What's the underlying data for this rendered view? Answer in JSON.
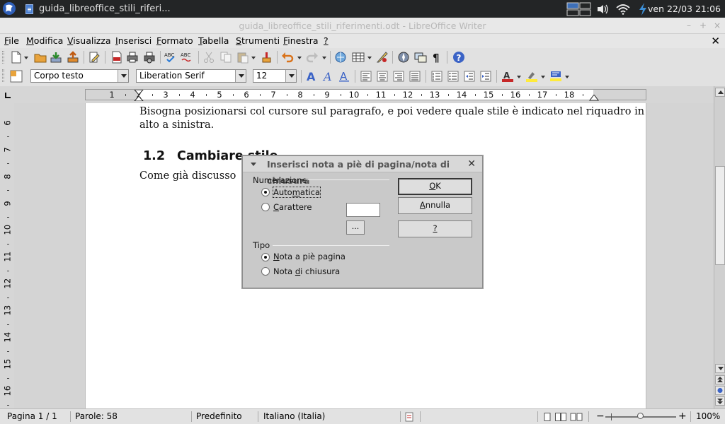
{
  "panel": {
    "task_title": "guida_libreoffice_stili_riferi...",
    "clock": "ven 22/03 21:06"
  },
  "window": {
    "title": "guida_libreoffice_stili_riferimenti.odt - LibreOffice Writer",
    "min": "–",
    "max": "+",
    "close": "×"
  },
  "menubar": {
    "items": [
      {
        "label": "File",
        "u": "F",
        "rest": "ile"
      },
      {
        "label": "Modifica",
        "u": "M",
        "rest": "odifica"
      },
      {
        "label": "Visualizza",
        "u": "V",
        "rest": "isualizza"
      },
      {
        "label": "Inserisci",
        "u": "I",
        "rest": "nserisci"
      },
      {
        "label": "Formato",
        "u": "F",
        "rest": "ormato"
      },
      {
        "label": "Tabella",
        "u": "T",
        "rest": "abella"
      },
      {
        "label": "Strumenti",
        "u": "S",
        "rest": "trumenti"
      },
      {
        "label": "Finestra",
        "u": "F",
        "rest": "inestra"
      },
      {
        "label": "?",
        "u": "?",
        "rest": ""
      }
    ],
    "close_doc": "✕"
  },
  "format_toolbar": {
    "paragraph_style": "Corpo testo",
    "font_name": "Liberation Serif",
    "font_size": "12"
  },
  "ruler": {
    "numbers": [
      "1",
      "2",
      "3",
      "4",
      "5",
      "6",
      "7",
      "8",
      "9",
      "10",
      "11",
      "12",
      "13",
      "14",
      "15",
      "16",
      "17",
      "18"
    ]
  },
  "vruler": {
    "numbers": [
      "6",
      "7",
      "8",
      "9",
      "10",
      "11",
      "12",
      "13",
      "14",
      "15",
      "16"
    ]
  },
  "document": {
    "para1_line1": "Bisogna posizionarsi col cursore sul paragrafo, e poi vedere quale stile è indicato nel riquadro in",
    "para1_line2": "alto a sinistra.",
    "heading_number": "1.2",
    "heading_text": "Cambiare stile",
    "para2": "Come già discusso"
  },
  "dialog": {
    "title": "Inserisci nota a piè di pagina/nota di chiusura",
    "close": "✕",
    "numbering_group": "Numerazione",
    "automatic": {
      "pre": "Auto",
      "u": "m",
      "post": "atica"
    },
    "character": {
      "pre": "",
      "u": "C",
      "post": "arattere"
    },
    "ellipsis": "...",
    "type_group": "Tipo",
    "footnote": {
      "pre": "",
      "u": "N",
      "post": "ota a piè pagina"
    },
    "endnote": {
      "pre": "Nota ",
      "u": "d",
      "post": "i chiusura"
    },
    "ok": {
      "pre": "",
      "u": "O",
      "post": "K"
    },
    "cancel": {
      "pre": "",
      "u": "A",
      "post": "nnulla"
    },
    "help": {
      "pre": "",
      "u": "?",
      "post": ""
    }
  },
  "statusbar": {
    "page": "Pagina 1 / 1",
    "words": "Parole: 58",
    "page_style": "Predefinito",
    "language": "Italiano (Italia)",
    "zoom": "100%"
  },
  "colors": {
    "panel_bg": "#232526",
    "toolbar_bg": "#e1e1e1",
    "dialog_bg": "#c9c9c9",
    "accent_blue": "#3b63c6"
  }
}
